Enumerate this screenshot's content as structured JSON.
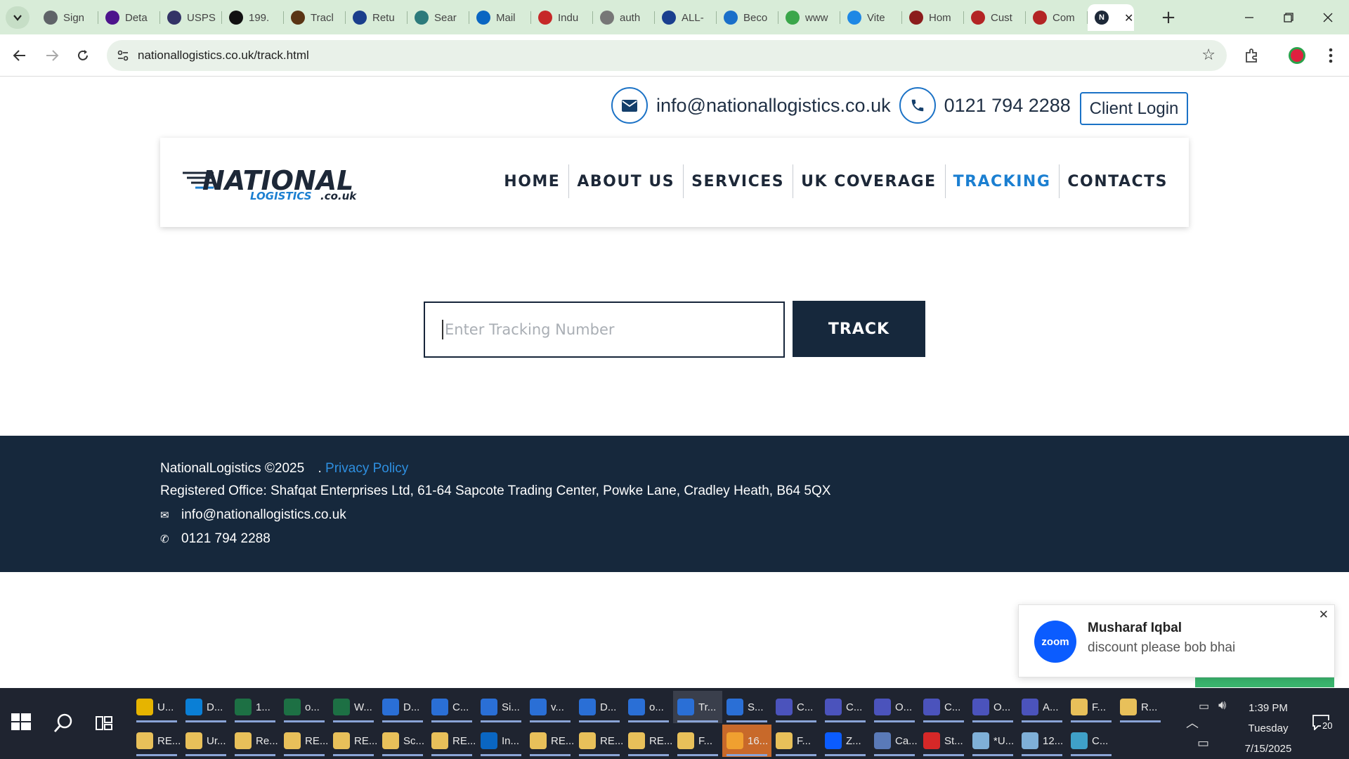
{
  "browser": {
    "tabs": [
      {
        "label": "Sign",
        "icon": "globe-icon",
        "color": "#5f6368"
      },
      {
        "label": "Deta",
        "icon": "fedex-icon",
        "color": "#4d148c"
      },
      {
        "label": "USPS",
        "icon": "usps-icon",
        "color": "#333366"
      },
      {
        "label": "199.",
        "icon": "triangle-icon",
        "color": "#111111"
      },
      {
        "label": "Tracl",
        "icon": "ups-icon",
        "color": "#5a3414"
      },
      {
        "label": "Retu",
        "icon": "v-icon",
        "color": "#1a3e8c"
      },
      {
        "label": "Sear",
        "icon": "search-globe-icon",
        "color": "#2c7a7b"
      },
      {
        "label": "Mail",
        "icon": "outlook-icon",
        "color": "#0a66c2"
      },
      {
        "label": "Indu",
        "icon": "stripes-icon",
        "color": "#c62828"
      },
      {
        "label": "auth",
        "icon": "globe-icon",
        "color": "#777777"
      },
      {
        "label": "ALL-",
        "icon": "17track-icon",
        "color": "#1a3f8f"
      },
      {
        "label": "Beco",
        "icon": "f-icon",
        "color": "#1a6fc9"
      },
      {
        "label": "www",
        "icon": "refresh-icon",
        "color": "#3aa64a"
      },
      {
        "label": "Vite",
        "icon": "dollar-icon",
        "color": "#1e88e5"
      },
      {
        "label": "Hom",
        "icon": "x-icon",
        "color": "#8b1c1c"
      },
      {
        "label": "Cust",
        "icon": "circle-icon",
        "color": "#b32424"
      },
      {
        "label": "Com",
        "icon": "circle-icon",
        "color": "#b32424"
      },
      {
        "label": "",
        "icon": "national-logistics-icon",
        "color": "#1d2838"
      }
    ],
    "url": "nationallogistics.co.uk/track.html"
  },
  "site": {
    "email": "info@nationallogistics.co.uk",
    "phone": "0121 794 2288",
    "client_login": "Client Login",
    "logo_main": "NATIONAL",
    "logo_sub": "LOGISTICS",
    "logo_tld": ".co.uk",
    "nav": [
      "HOME",
      "ABOUT US",
      "SERVICES",
      "UK COVERAGE",
      "TRACKING",
      "CONTACTS"
    ],
    "active_nav": "TRACKING",
    "tracking_placeholder": "Enter Tracking Number",
    "track_button": "TRACK",
    "footer": {
      "copyright": "NationalLogistics ©2025",
      "separator": ".",
      "privacy": "Privacy Policy",
      "address": "Registered Office: Shafqat Enterprises Ltd, 61-64 Sapcote Trading Center, Powke Lane, Cradley Heath, B64 5QX",
      "email": "info@nationallogistics.co.uk",
      "phone": "0121 794 2288"
    },
    "colors": {
      "navy": "#16283c",
      "accent": "#1b7fd1"
    }
  },
  "notification": {
    "app": "zoom",
    "sender": "Musharaf Iqbal",
    "message": "discount please bob bhai"
  },
  "taskbar": {
    "row1": [
      {
        "label": "U...",
        "color": "#e6b400"
      },
      {
        "label": "D...",
        "color": "#0a7fd6"
      },
      {
        "label": "1...",
        "color": "#1d7044"
      },
      {
        "label": "o...",
        "color": "#1d7044"
      },
      {
        "label": "W...",
        "color": "#1d7044"
      },
      {
        "label": "D...",
        "color": "#2a6fd6"
      },
      {
        "label": "C...",
        "color": "#2a6fd6"
      },
      {
        "label": "Si...",
        "color": "#2a6fd6"
      },
      {
        "label": "v...",
        "color": "#2a6fd6"
      },
      {
        "label": "D...",
        "color": "#2a6fd6"
      },
      {
        "label": "o...",
        "color": "#2a6fd6"
      },
      {
        "label": "Tr...",
        "color": "#2a6fd6"
      },
      {
        "label": "S...",
        "color": "#2a6fd6"
      },
      {
        "label": "C...",
        "color": "#4b53bc"
      },
      {
        "label": "C...",
        "color": "#4b53bc"
      },
      {
        "label": "O...",
        "color": "#4b53bc"
      },
      {
        "label": "C...",
        "color": "#4b53bc"
      },
      {
        "label": "O...",
        "color": "#4b53bc"
      },
      {
        "label": "A...",
        "color": "#4b53bc"
      },
      {
        "label": "F...",
        "color": "#e8c05a"
      },
      {
        "label": "R...",
        "color": "#e8c05a"
      }
    ],
    "row2": [
      {
        "label": "RE...",
        "color": "#e8c05a"
      },
      {
        "label": "Ur...",
        "color": "#e8c05a"
      },
      {
        "label": "Re...",
        "color": "#e8c05a"
      },
      {
        "label": "RE...",
        "color": "#e8c05a"
      },
      {
        "label": "RE...",
        "color": "#e8c05a"
      },
      {
        "label": "Sc...",
        "color": "#e8c05a"
      },
      {
        "label": "RE...",
        "color": "#e8c05a"
      },
      {
        "label": "In...",
        "color": "#0a66c2"
      },
      {
        "label": "RE...",
        "color": "#e8c05a"
      },
      {
        "label": "RE...",
        "color": "#e8c05a"
      },
      {
        "label": "RE...",
        "color": "#e8c05a"
      },
      {
        "label": "F...",
        "color": "#e8c05a"
      },
      {
        "label": "16...",
        "color": "#f0a030"
      },
      {
        "label": "F...",
        "color": "#e8c05a"
      },
      {
        "label": "Z...",
        "color": "#0b5cff"
      },
      {
        "label": "Ca...",
        "color": "#5a7ab8"
      },
      {
        "label": "St...",
        "color": "#d62828"
      },
      {
        "label": "*U...",
        "color": "#7fb0d8"
      },
      {
        "label": "12...",
        "color": "#7fb0d8"
      },
      {
        "label": "C...",
        "color": "#3fa0c8"
      }
    ],
    "time": "1:39 PM",
    "day": "Tuesday",
    "date": "7/15/2025",
    "notification_count": "20"
  }
}
